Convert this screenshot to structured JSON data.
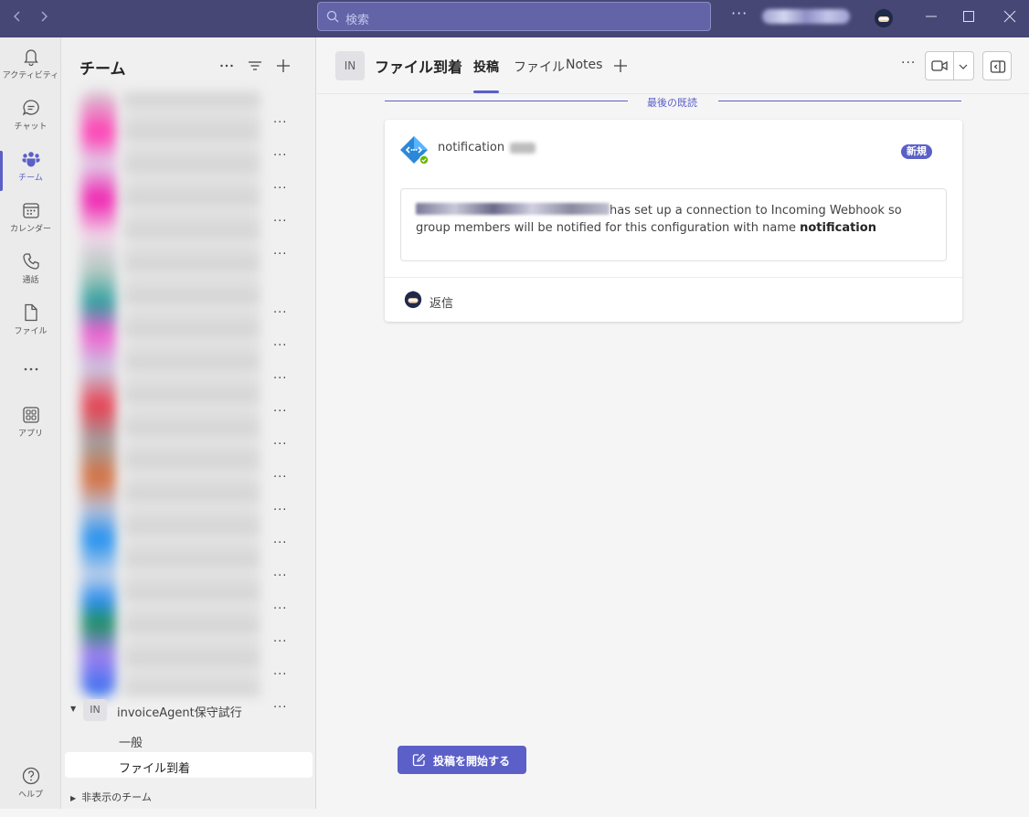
{
  "titlebar": {
    "search_placeholder": "検索",
    "back_icon": "chevron-left-icon",
    "forward_icon": "chevron-right-icon"
  },
  "rail": {
    "items": [
      {
        "label": "アクティビティ",
        "icon": "bell-icon"
      },
      {
        "label": "チャット",
        "icon": "chat-icon"
      },
      {
        "label": "チーム",
        "icon": "teams-icon",
        "active": true
      },
      {
        "label": "カレンダー",
        "icon": "calendar-icon"
      },
      {
        "label": "通話",
        "icon": "phone-icon"
      },
      {
        "label": "ファイル",
        "icon": "file-icon"
      },
      {
        "label": "",
        "icon": "more-icon"
      },
      {
        "label": "アプリ",
        "icon": "apps-icon"
      }
    ],
    "help_label": "ヘルプ"
  },
  "teams_panel": {
    "title": "チーム",
    "team": {
      "avatar": "IN",
      "name": "invoiceAgent保守試行"
    },
    "channels": [
      {
        "name": "一般",
        "selected": false
      },
      {
        "name": "ファイル到着",
        "selected": true
      }
    ],
    "hidden_teams_label": "非表示のチーム"
  },
  "channel_header": {
    "avatar": "IN",
    "title": "ファイル到着",
    "tabs": [
      "投稿",
      "ファイル",
      "Notes"
    ]
  },
  "feed": {
    "last_read_label": "最後の既読",
    "post": {
      "sender": "notification",
      "badge": "新規",
      "message_text": "has set up a connection to Incoming Webhook so group members will be notified for this configuration with name",
      "message_bold": "notification",
      "reply_label": "返信"
    },
    "start_post_label": "投稿を開始する"
  },
  "colors": {
    "brand": "#5b5fc7",
    "titlebar": "#464775"
  }
}
